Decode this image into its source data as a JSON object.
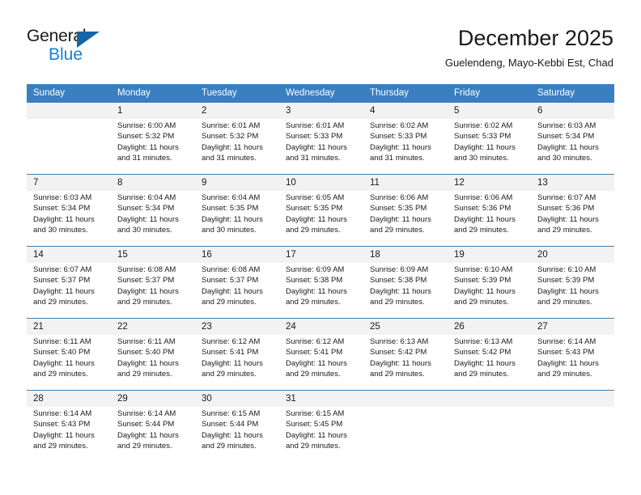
{
  "brand": {
    "name_part1": "General",
    "name_part2": "Blue",
    "triangle_icon": "triangle-icon",
    "color_dark": "#1a1a1a",
    "color_blue": "#1b7fd4"
  },
  "header": {
    "month_title": "December 2025",
    "location": "Guelendeng, Mayo-Kebbi Est, Chad"
  },
  "calendar": {
    "header_bg": "#3a7fc0",
    "daynum_bg": "#f2f2f2",
    "weekday_headers": [
      "Sunday",
      "Monday",
      "Tuesday",
      "Wednesday",
      "Thursday",
      "Friday",
      "Saturday"
    ],
    "weeks": [
      [
        {
          "day": "",
          "sunrise": "",
          "sunset": "",
          "daylight_line1": "",
          "daylight_line2": ""
        },
        {
          "day": "1",
          "sunrise": "Sunrise: 6:00 AM",
          "sunset": "Sunset: 5:32 PM",
          "daylight_line1": "Daylight: 11 hours",
          "daylight_line2": "and 31 minutes."
        },
        {
          "day": "2",
          "sunrise": "Sunrise: 6:01 AM",
          "sunset": "Sunset: 5:32 PM",
          "daylight_line1": "Daylight: 11 hours",
          "daylight_line2": "and 31 minutes."
        },
        {
          "day": "3",
          "sunrise": "Sunrise: 6:01 AM",
          "sunset": "Sunset: 5:33 PM",
          "daylight_line1": "Daylight: 11 hours",
          "daylight_line2": "and 31 minutes."
        },
        {
          "day": "4",
          "sunrise": "Sunrise: 6:02 AM",
          "sunset": "Sunset: 5:33 PM",
          "daylight_line1": "Daylight: 11 hours",
          "daylight_line2": "and 31 minutes."
        },
        {
          "day": "5",
          "sunrise": "Sunrise: 6:02 AM",
          "sunset": "Sunset: 5:33 PM",
          "daylight_line1": "Daylight: 11 hours",
          "daylight_line2": "and 30 minutes."
        },
        {
          "day": "6",
          "sunrise": "Sunrise: 6:03 AM",
          "sunset": "Sunset: 5:34 PM",
          "daylight_line1": "Daylight: 11 hours",
          "daylight_line2": "and 30 minutes."
        }
      ],
      [
        {
          "day": "7",
          "sunrise": "Sunrise: 6:03 AM",
          "sunset": "Sunset: 5:34 PM",
          "daylight_line1": "Daylight: 11 hours",
          "daylight_line2": "and 30 minutes."
        },
        {
          "day": "8",
          "sunrise": "Sunrise: 6:04 AM",
          "sunset": "Sunset: 5:34 PM",
          "daylight_line1": "Daylight: 11 hours",
          "daylight_line2": "and 30 minutes."
        },
        {
          "day": "9",
          "sunrise": "Sunrise: 6:04 AM",
          "sunset": "Sunset: 5:35 PM",
          "daylight_line1": "Daylight: 11 hours",
          "daylight_line2": "and 30 minutes."
        },
        {
          "day": "10",
          "sunrise": "Sunrise: 6:05 AM",
          "sunset": "Sunset: 5:35 PM",
          "daylight_line1": "Daylight: 11 hours",
          "daylight_line2": "and 29 minutes."
        },
        {
          "day": "11",
          "sunrise": "Sunrise: 6:06 AM",
          "sunset": "Sunset: 5:35 PM",
          "daylight_line1": "Daylight: 11 hours",
          "daylight_line2": "and 29 minutes."
        },
        {
          "day": "12",
          "sunrise": "Sunrise: 6:06 AM",
          "sunset": "Sunset: 5:36 PM",
          "daylight_line1": "Daylight: 11 hours",
          "daylight_line2": "and 29 minutes."
        },
        {
          "day": "13",
          "sunrise": "Sunrise: 6:07 AM",
          "sunset": "Sunset: 5:36 PM",
          "daylight_line1": "Daylight: 11 hours",
          "daylight_line2": "and 29 minutes."
        }
      ],
      [
        {
          "day": "14",
          "sunrise": "Sunrise: 6:07 AM",
          "sunset": "Sunset: 5:37 PM",
          "daylight_line1": "Daylight: 11 hours",
          "daylight_line2": "and 29 minutes."
        },
        {
          "day": "15",
          "sunrise": "Sunrise: 6:08 AM",
          "sunset": "Sunset: 5:37 PM",
          "daylight_line1": "Daylight: 11 hours",
          "daylight_line2": "and 29 minutes."
        },
        {
          "day": "16",
          "sunrise": "Sunrise: 6:08 AM",
          "sunset": "Sunset: 5:37 PM",
          "daylight_line1": "Daylight: 11 hours",
          "daylight_line2": "and 29 minutes."
        },
        {
          "day": "17",
          "sunrise": "Sunrise: 6:09 AM",
          "sunset": "Sunset: 5:38 PM",
          "daylight_line1": "Daylight: 11 hours",
          "daylight_line2": "and 29 minutes."
        },
        {
          "day": "18",
          "sunrise": "Sunrise: 6:09 AM",
          "sunset": "Sunset: 5:38 PM",
          "daylight_line1": "Daylight: 11 hours",
          "daylight_line2": "and 29 minutes."
        },
        {
          "day": "19",
          "sunrise": "Sunrise: 6:10 AM",
          "sunset": "Sunset: 5:39 PM",
          "daylight_line1": "Daylight: 11 hours",
          "daylight_line2": "and 29 minutes."
        },
        {
          "day": "20",
          "sunrise": "Sunrise: 6:10 AM",
          "sunset": "Sunset: 5:39 PM",
          "daylight_line1": "Daylight: 11 hours",
          "daylight_line2": "and 29 minutes."
        }
      ],
      [
        {
          "day": "21",
          "sunrise": "Sunrise: 6:11 AM",
          "sunset": "Sunset: 5:40 PM",
          "daylight_line1": "Daylight: 11 hours",
          "daylight_line2": "and 29 minutes."
        },
        {
          "day": "22",
          "sunrise": "Sunrise: 6:11 AM",
          "sunset": "Sunset: 5:40 PM",
          "daylight_line1": "Daylight: 11 hours",
          "daylight_line2": "and 29 minutes."
        },
        {
          "day": "23",
          "sunrise": "Sunrise: 6:12 AM",
          "sunset": "Sunset: 5:41 PM",
          "daylight_line1": "Daylight: 11 hours",
          "daylight_line2": "and 29 minutes."
        },
        {
          "day": "24",
          "sunrise": "Sunrise: 6:12 AM",
          "sunset": "Sunset: 5:41 PM",
          "daylight_line1": "Daylight: 11 hours",
          "daylight_line2": "and 29 minutes."
        },
        {
          "day": "25",
          "sunrise": "Sunrise: 6:13 AM",
          "sunset": "Sunset: 5:42 PM",
          "daylight_line1": "Daylight: 11 hours",
          "daylight_line2": "and 29 minutes."
        },
        {
          "day": "26",
          "sunrise": "Sunrise: 6:13 AM",
          "sunset": "Sunset: 5:42 PM",
          "daylight_line1": "Daylight: 11 hours",
          "daylight_line2": "and 29 minutes."
        },
        {
          "day": "27",
          "sunrise": "Sunrise: 6:14 AM",
          "sunset": "Sunset: 5:43 PM",
          "daylight_line1": "Daylight: 11 hours",
          "daylight_line2": "and 29 minutes."
        }
      ],
      [
        {
          "day": "28",
          "sunrise": "Sunrise: 6:14 AM",
          "sunset": "Sunset: 5:43 PM",
          "daylight_line1": "Daylight: 11 hours",
          "daylight_line2": "and 29 minutes."
        },
        {
          "day": "29",
          "sunrise": "Sunrise: 6:14 AM",
          "sunset": "Sunset: 5:44 PM",
          "daylight_line1": "Daylight: 11 hours",
          "daylight_line2": "and 29 minutes."
        },
        {
          "day": "30",
          "sunrise": "Sunrise: 6:15 AM",
          "sunset": "Sunset: 5:44 PM",
          "daylight_line1": "Daylight: 11 hours",
          "daylight_line2": "and 29 minutes."
        },
        {
          "day": "31",
          "sunrise": "Sunrise: 6:15 AM",
          "sunset": "Sunset: 5:45 PM",
          "daylight_line1": "Daylight: 11 hours",
          "daylight_line2": "and 29 minutes."
        },
        {
          "day": "",
          "sunrise": "",
          "sunset": "",
          "daylight_line1": "",
          "daylight_line2": ""
        },
        {
          "day": "",
          "sunrise": "",
          "sunset": "",
          "daylight_line1": "",
          "daylight_line2": ""
        },
        {
          "day": "",
          "sunrise": "",
          "sunset": "",
          "daylight_line1": "",
          "daylight_line2": ""
        }
      ]
    ]
  }
}
